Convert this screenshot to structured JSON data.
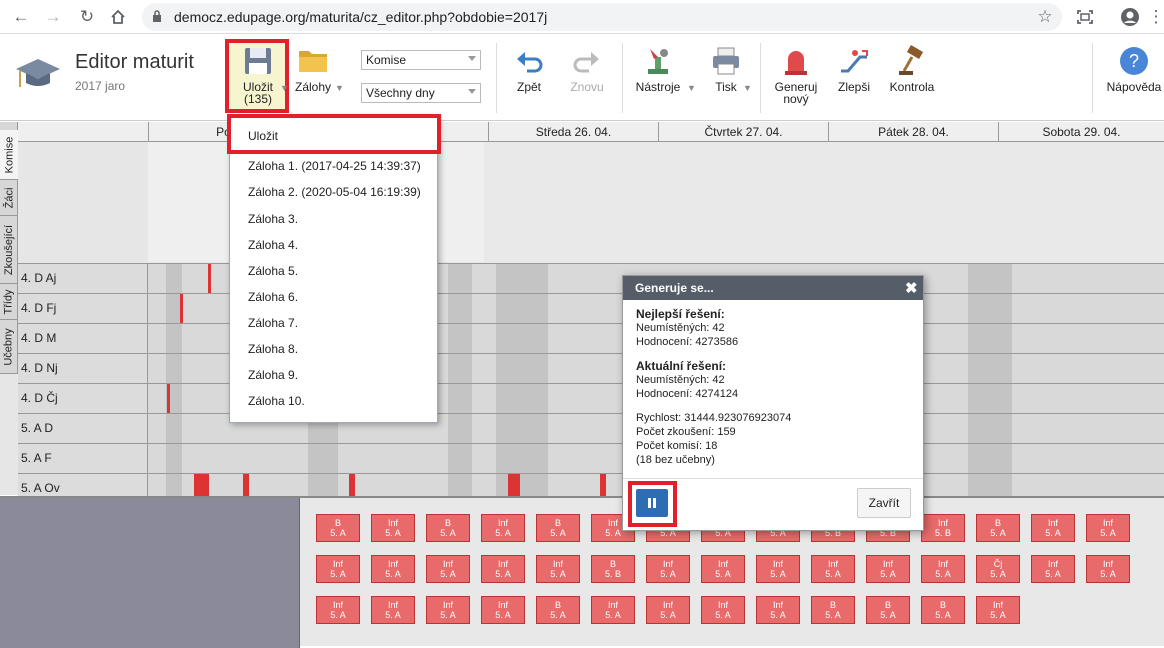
{
  "browser": {
    "url": "democz.edupage.org/maturita/cz_editor.php?obdobie=2017j"
  },
  "app": {
    "title": "Editor maturit",
    "subtitle": "2017 jaro"
  },
  "toolbar": {
    "save_label": "Uložit",
    "save_count": "(135)",
    "backups_label": "Zálohy",
    "select_commission": "Komise",
    "select_days": "Všechny dny",
    "undo_label": "Zpět",
    "redo_label": "Znovu",
    "tools_label": "Nástroje",
    "print_label": "Tisk",
    "generate_label_1": "Generuj",
    "generate_label_2": "nový",
    "improve_label": "Zlepši",
    "check_label": "Kontrola",
    "help_label": "Nápověda"
  },
  "days": [
    "Pondě",
    "Středa 26. 04.",
    "Čtvrtek 27. 04.",
    "Pátek 28. 04.",
    "Sobota 29. 04."
  ],
  "vertical_tabs": [
    "Komise",
    "Žáci",
    "Zkoušející",
    "Třídy",
    "Učebny"
  ],
  "rows": [
    "4. D Aj",
    "4. D Fj",
    "4. D M",
    "4. D Nj",
    "4. D Čj",
    "5. A D",
    "5. A F",
    "5. A Ov"
  ],
  "dropdown": {
    "items": [
      "Uložit",
      "Záloha 1. (2017-04-25 14:39:37)",
      "Záloha 2. (2020-05-04 16:19:39)",
      "Záloha 3.",
      "Záloha 4.",
      "Záloha 5.",
      "Záloha 6.",
      "Záloha 7.",
      "Záloha 8.",
      "Záloha 9.",
      "Záloha 10."
    ]
  },
  "dialog": {
    "title": "Generuje se...",
    "best_heading": "Nejlepší řešení:",
    "best_unplaced": "Neumístěných: 42",
    "best_score": "Hodnocení: 4273586",
    "current_heading": "Aktuální řešení:",
    "current_unplaced": "Neumístěných: 42",
    "current_score": "Hodnocení: 4274124",
    "speed": "Rychlost: 31444.923076923074",
    "exams": "Počet zkoušení: 159",
    "commissions": "Počet komisí: 18",
    "without_room": "(18 bez učebny)",
    "close_label": "Zavřít"
  },
  "cards": {
    "row1": [
      [
        "B",
        "5. A"
      ],
      [
        "Inf",
        "5. A"
      ],
      [
        "B",
        "5. A"
      ],
      [
        "Inf",
        "5. A"
      ],
      [
        "B",
        "5. A"
      ],
      [
        "Inf",
        "5. A"
      ],
      [
        "B",
        "5. A"
      ],
      [
        "Inf",
        "5. A"
      ],
      [
        "B",
        "5. A"
      ],
      [
        "B",
        "5. B"
      ],
      [
        "B",
        "5. B"
      ],
      [
        "Inf",
        "5. B"
      ],
      [
        "B",
        "5. A"
      ],
      [
        "Inf",
        "5. A"
      ],
      [
        "Inf",
        "5. A"
      ]
    ],
    "row2": [
      [
        "Inf",
        "5. A"
      ],
      [
        "Inf",
        "5. A"
      ],
      [
        "Inf",
        "5. A"
      ],
      [
        "Inf",
        "5. A"
      ],
      [
        "Inf",
        "5. A"
      ],
      [
        "B",
        "5. B"
      ],
      [
        "Inf",
        "5. A"
      ],
      [
        "Inf",
        "5. A"
      ],
      [
        "Inf",
        "5. A"
      ],
      [
        "Inf",
        "5. A"
      ],
      [
        "Inf",
        "5. A"
      ],
      [
        "Inf",
        "5. A"
      ],
      [
        "Čj",
        "5. A"
      ],
      [
        "Inf",
        "5. A"
      ],
      [
        "Inf",
        "5. A"
      ]
    ],
    "row3": [
      [
        "Inf",
        "5. A"
      ],
      [
        "Inf",
        "5. A"
      ],
      [
        "Inf",
        "5. A"
      ],
      [
        "Inf",
        "5. A"
      ],
      [
        "B",
        "5. A"
      ],
      [
        "Inf",
        "5. A"
      ],
      [
        "Inf",
        "5. A"
      ],
      [
        "Inf",
        "5. A"
      ],
      [
        "Inf",
        "5. A"
      ],
      [
        "B",
        "5. A"
      ],
      [
        "B",
        "5. A"
      ],
      [
        "B",
        "5. A"
      ],
      [
        "Inf",
        "5. A"
      ]
    ]
  },
  "colors": {
    "highlight": "#e0202a",
    "card": "#e86a6a",
    "dialog_title": "#555d68",
    "pause_button": "#2e6db4"
  }
}
